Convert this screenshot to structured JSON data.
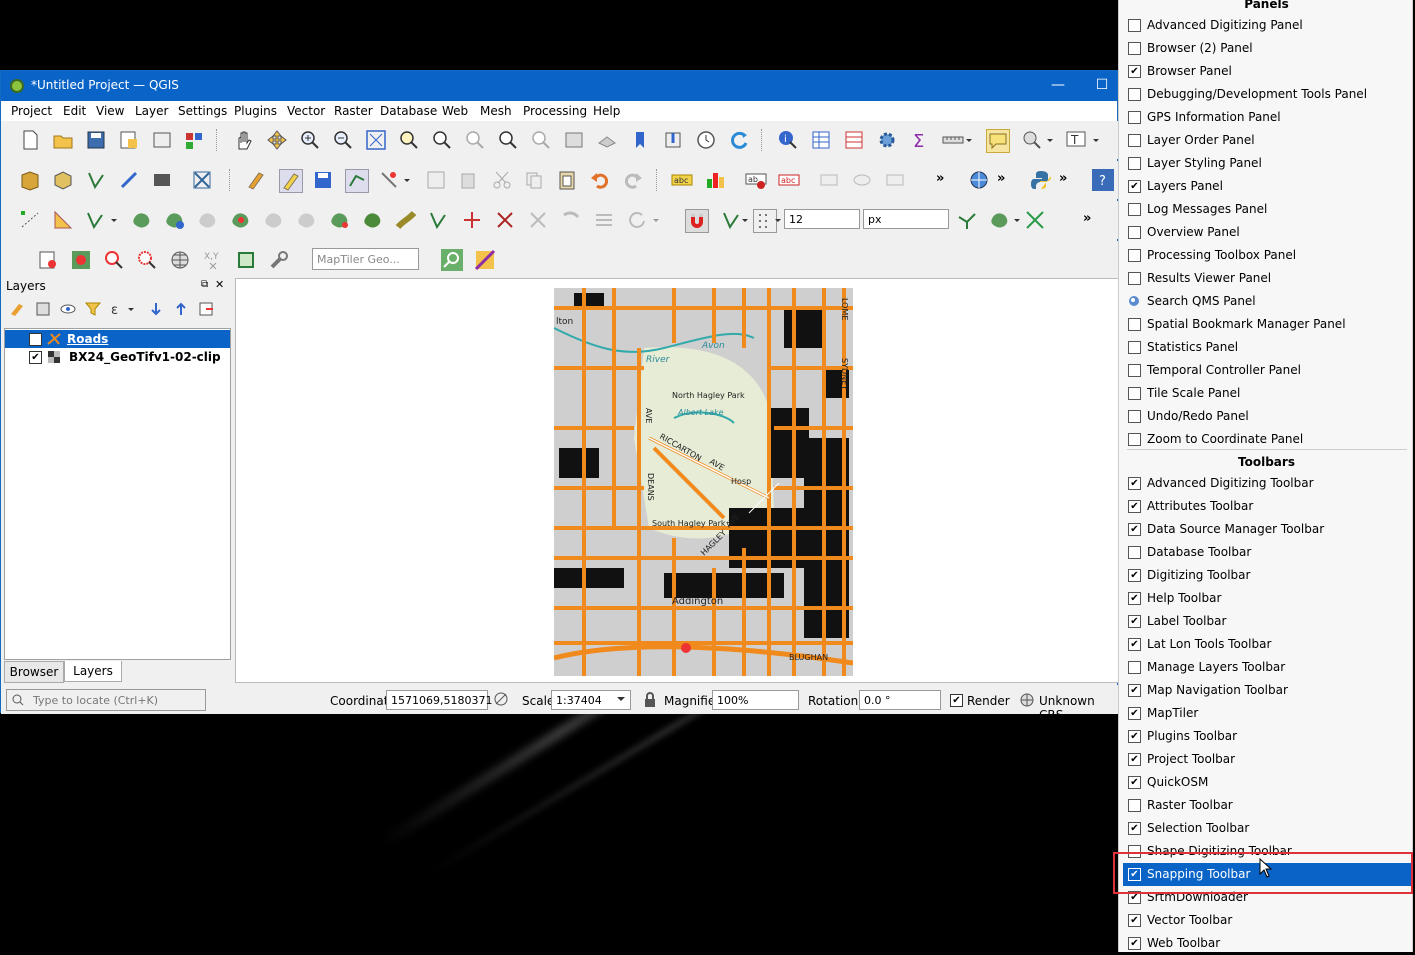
{
  "window": {
    "title": "*Untitled Project — QGIS",
    "minimize": "—",
    "maximize": "☐"
  },
  "menubar": [
    "Project",
    "Edit",
    "View",
    "Layer",
    "Settings",
    "Plugins",
    "Vector",
    "Raster",
    "Database",
    "Web",
    "Mesh",
    "Processing",
    "Help"
  ],
  "toolbar": {
    "snap_tolerance": "12",
    "snap_units": "px",
    "search_placeholder": "MapTiler Geo..."
  },
  "layers_panel": {
    "title": "Layers",
    "layers": [
      {
        "name": "Roads",
        "checked": true,
        "selected": true
      },
      {
        "name": "BX24_GeoTifv1-02-clip",
        "checked": true,
        "selected": false
      }
    ],
    "tabs": [
      "Browser",
      "Layers"
    ]
  },
  "map": {
    "labels": [
      "lton",
      "River",
      "Avon",
      "North Hagley Park",
      "Albert Lake",
      "RICCARTON",
      "AVE",
      "Hosp",
      "DEANS",
      "AVE",
      "South Hagley Park",
      "HAGLEY",
      "AVE",
      "Addington",
      "LOME",
      "SYDNEY",
      "BLUGHAN"
    ]
  },
  "statusbar": {
    "locator_placeholder": "Type to locate (Ctrl+K)",
    "coordinate_label": "Coordinate",
    "coordinate_value": "1571069,5180371",
    "scale_label": "Scale",
    "scale_value": "1:37404",
    "magnifier_label": "Magnifier",
    "magnifier_value": "100%",
    "rotation_label": "Rotation",
    "rotation_value": "0.0 °",
    "render_label": "Render",
    "crs_label": "Unknown CRS"
  },
  "dropdown": {
    "panels_header": "Panels",
    "panels": [
      {
        "label": "Advanced Digitizing Panel",
        "checked": false
      },
      {
        "label": "Browser (2) Panel",
        "checked": false
      },
      {
        "label": "Browser Panel",
        "checked": true
      },
      {
        "label": "Debugging/Development Tools Panel",
        "checked": false
      },
      {
        "label": "GPS Information Panel",
        "checked": false
      },
      {
        "label": "Layer Order Panel",
        "checked": false
      },
      {
        "label": "Layer Styling Panel",
        "checked": false
      },
      {
        "label": "Layers Panel",
        "checked": true
      },
      {
        "label": "Log Messages Panel",
        "checked": false
      },
      {
        "label": "Overview Panel",
        "checked": false
      },
      {
        "label": "Processing Toolbox Panel",
        "checked": false
      },
      {
        "label": "Results Viewer Panel",
        "checked": false
      },
      {
        "label": "Search QMS Panel",
        "checked": false,
        "icon": true
      },
      {
        "label": "Spatial Bookmark Manager Panel",
        "checked": false
      },
      {
        "label": "Statistics Panel",
        "checked": false
      },
      {
        "label": "Temporal Controller Panel",
        "checked": false
      },
      {
        "label": "Tile Scale Panel",
        "checked": false
      },
      {
        "label": "Undo/Redo Panel",
        "checked": false
      },
      {
        "label": "Zoom to Coordinate Panel",
        "checked": false
      }
    ],
    "toolbars_header": "Toolbars",
    "toolbars": [
      {
        "label": "Advanced Digitizing Toolbar",
        "checked": true
      },
      {
        "label": "Attributes Toolbar",
        "checked": true
      },
      {
        "label": "Data Source Manager Toolbar",
        "checked": true
      },
      {
        "label": "Database Toolbar",
        "checked": false
      },
      {
        "label": "Digitizing Toolbar",
        "checked": true
      },
      {
        "label": "Help Toolbar",
        "checked": true
      },
      {
        "label": "Label Toolbar",
        "checked": true
      },
      {
        "label": "Lat Lon Tools Toolbar",
        "checked": true
      },
      {
        "label": "Manage Layers Toolbar",
        "checked": false
      },
      {
        "label": "Map Navigation Toolbar",
        "checked": true
      },
      {
        "label": "MapTiler",
        "checked": true
      },
      {
        "label": "Plugins Toolbar",
        "checked": true
      },
      {
        "label": "Project Toolbar",
        "checked": true
      },
      {
        "label": "QuickOSM",
        "checked": true
      },
      {
        "label": "Raster Toolbar",
        "checked": false
      },
      {
        "label": "Selection Toolbar",
        "checked": true
      },
      {
        "label": "Shape Digitizing Toolbar",
        "checked": false
      },
      {
        "label": "Snapping Toolbar",
        "checked": true,
        "selected": true
      },
      {
        "label": "SrtmDownloader",
        "checked": true
      },
      {
        "label": "Vector Toolbar",
        "checked": true
      },
      {
        "label": "Web Toolbar",
        "checked": true
      }
    ]
  },
  "colors": {
    "titlebar": "#0a64c8",
    "selection": "#0a64c8",
    "highlight_box": "#e0303a",
    "road": "#f08a1c"
  }
}
